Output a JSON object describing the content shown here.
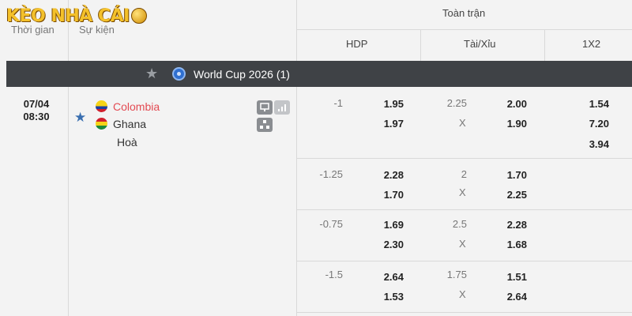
{
  "logo": {
    "text": "KÈO NHÀ CÁI"
  },
  "columns": {
    "time": "Thời gian",
    "event": "Sự kiện"
  },
  "markets": {
    "period": "Toàn trận",
    "hdp": "HDP",
    "ou": "Tài/Xỉu",
    "onex2": "1X2"
  },
  "league": {
    "name": "World Cup 2026",
    "count": "(1)",
    "icon": "globe-icon"
  },
  "match": {
    "date": "07/04",
    "time": "08:30",
    "home": "Colombia",
    "away": "Ghana",
    "draw": "Hoà",
    "colors": {
      "home_text": "#e34b53"
    }
  },
  "rows": [
    {
      "hdp_line": "-1",
      "hdp_home": "1.95",
      "hdp_away": "1.97",
      "ou_line": "2.25",
      "ou_x": "X",
      "ou_over": "2.00",
      "ou_under": "1.90",
      "x12_home": "1.54",
      "x12_away": "7.20",
      "x12_draw": "3.94"
    },
    {
      "hdp_line": "-1.25",
      "hdp_home": "2.28",
      "hdp_away": "1.70",
      "ou_line": "2",
      "ou_x": "X",
      "ou_over": "1.70",
      "ou_under": "2.25"
    },
    {
      "hdp_line": "-0.75",
      "hdp_home": "1.69",
      "hdp_away": "2.30",
      "ou_line": "2.5",
      "ou_x": "X",
      "ou_over": "2.28",
      "ou_under": "1.68"
    },
    {
      "hdp_line": "-1.5",
      "hdp_home": "2.64",
      "hdp_away": "1.53",
      "ou_line": "1.75",
      "ou_x": "X",
      "ou_over": "1.51",
      "ou_under": "2.64"
    }
  ]
}
